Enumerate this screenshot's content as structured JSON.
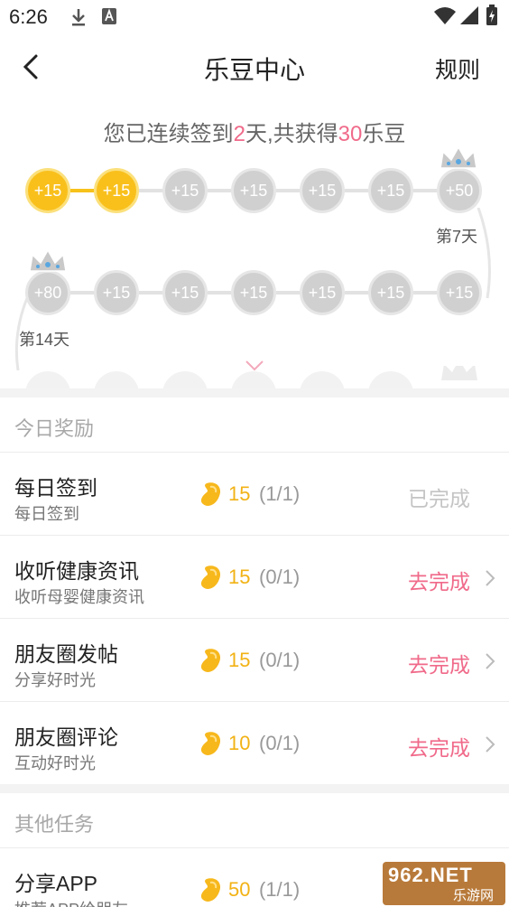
{
  "status_bar": {
    "time": "6:26",
    "icons": [
      "download-icon",
      "a-icon",
      "wifi-icon",
      "signal-icon",
      "battery-icon"
    ]
  },
  "nav": {
    "title": "乐豆中心",
    "rules": "规则"
  },
  "streak": {
    "prefix": "您已连续签到",
    "days": "2",
    "middle": "天,共获得",
    "beans": "30",
    "suffix": "乐豆"
  },
  "checkin": {
    "row1": [
      "+15",
      "+15",
      "+15",
      "+15",
      "+15",
      "+15",
      "+50"
    ],
    "row1_done": 2,
    "row1_label": "第7天",
    "row2": [
      "+80",
      "+15",
      "+15",
      "+15",
      "+15",
      "+15",
      "+15"
    ],
    "row2_label": "第14天"
  },
  "today": {
    "title": "今日奖励",
    "tasks": [
      {
        "name": "每日签到",
        "sub": "每日签到",
        "reward": "15",
        "progress": "(1/1)",
        "action": "已完成"
      },
      {
        "name": "收听健康资讯",
        "sub": "收听母婴健康资讯",
        "reward": "15",
        "progress": "(0/1)",
        "action": "去完成"
      },
      {
        "name": "朋友圈发帖",
        "sub": "分享好时光",
        "reward": "15",
        "progress": "(0/1)",
        "action": "去完成"
      },
      {
        "name": "朋友圈评论",
        "sub": "互动好时光",
        "reward": "10",
        "progress": "(0/1)",
        "action": "去完成"
      }
    ]
  },
  "other": {
    "title": "其他任务",
    "tasks": [
      {
        "name": "分享APP",
        "sub": "推荐APP给朋友",
        "reward": "50",
        "progress": "(1/1)"
      }
    ]
  },
  "watermark": {
    "top": "962.NET",
    "bottom": "乐游网"
  },
  "colors": {
    "accent": "#f06a8a",
    "gold": "#f9c01c",
    "gray_bubble": "#d0d0d0"
  }
}
